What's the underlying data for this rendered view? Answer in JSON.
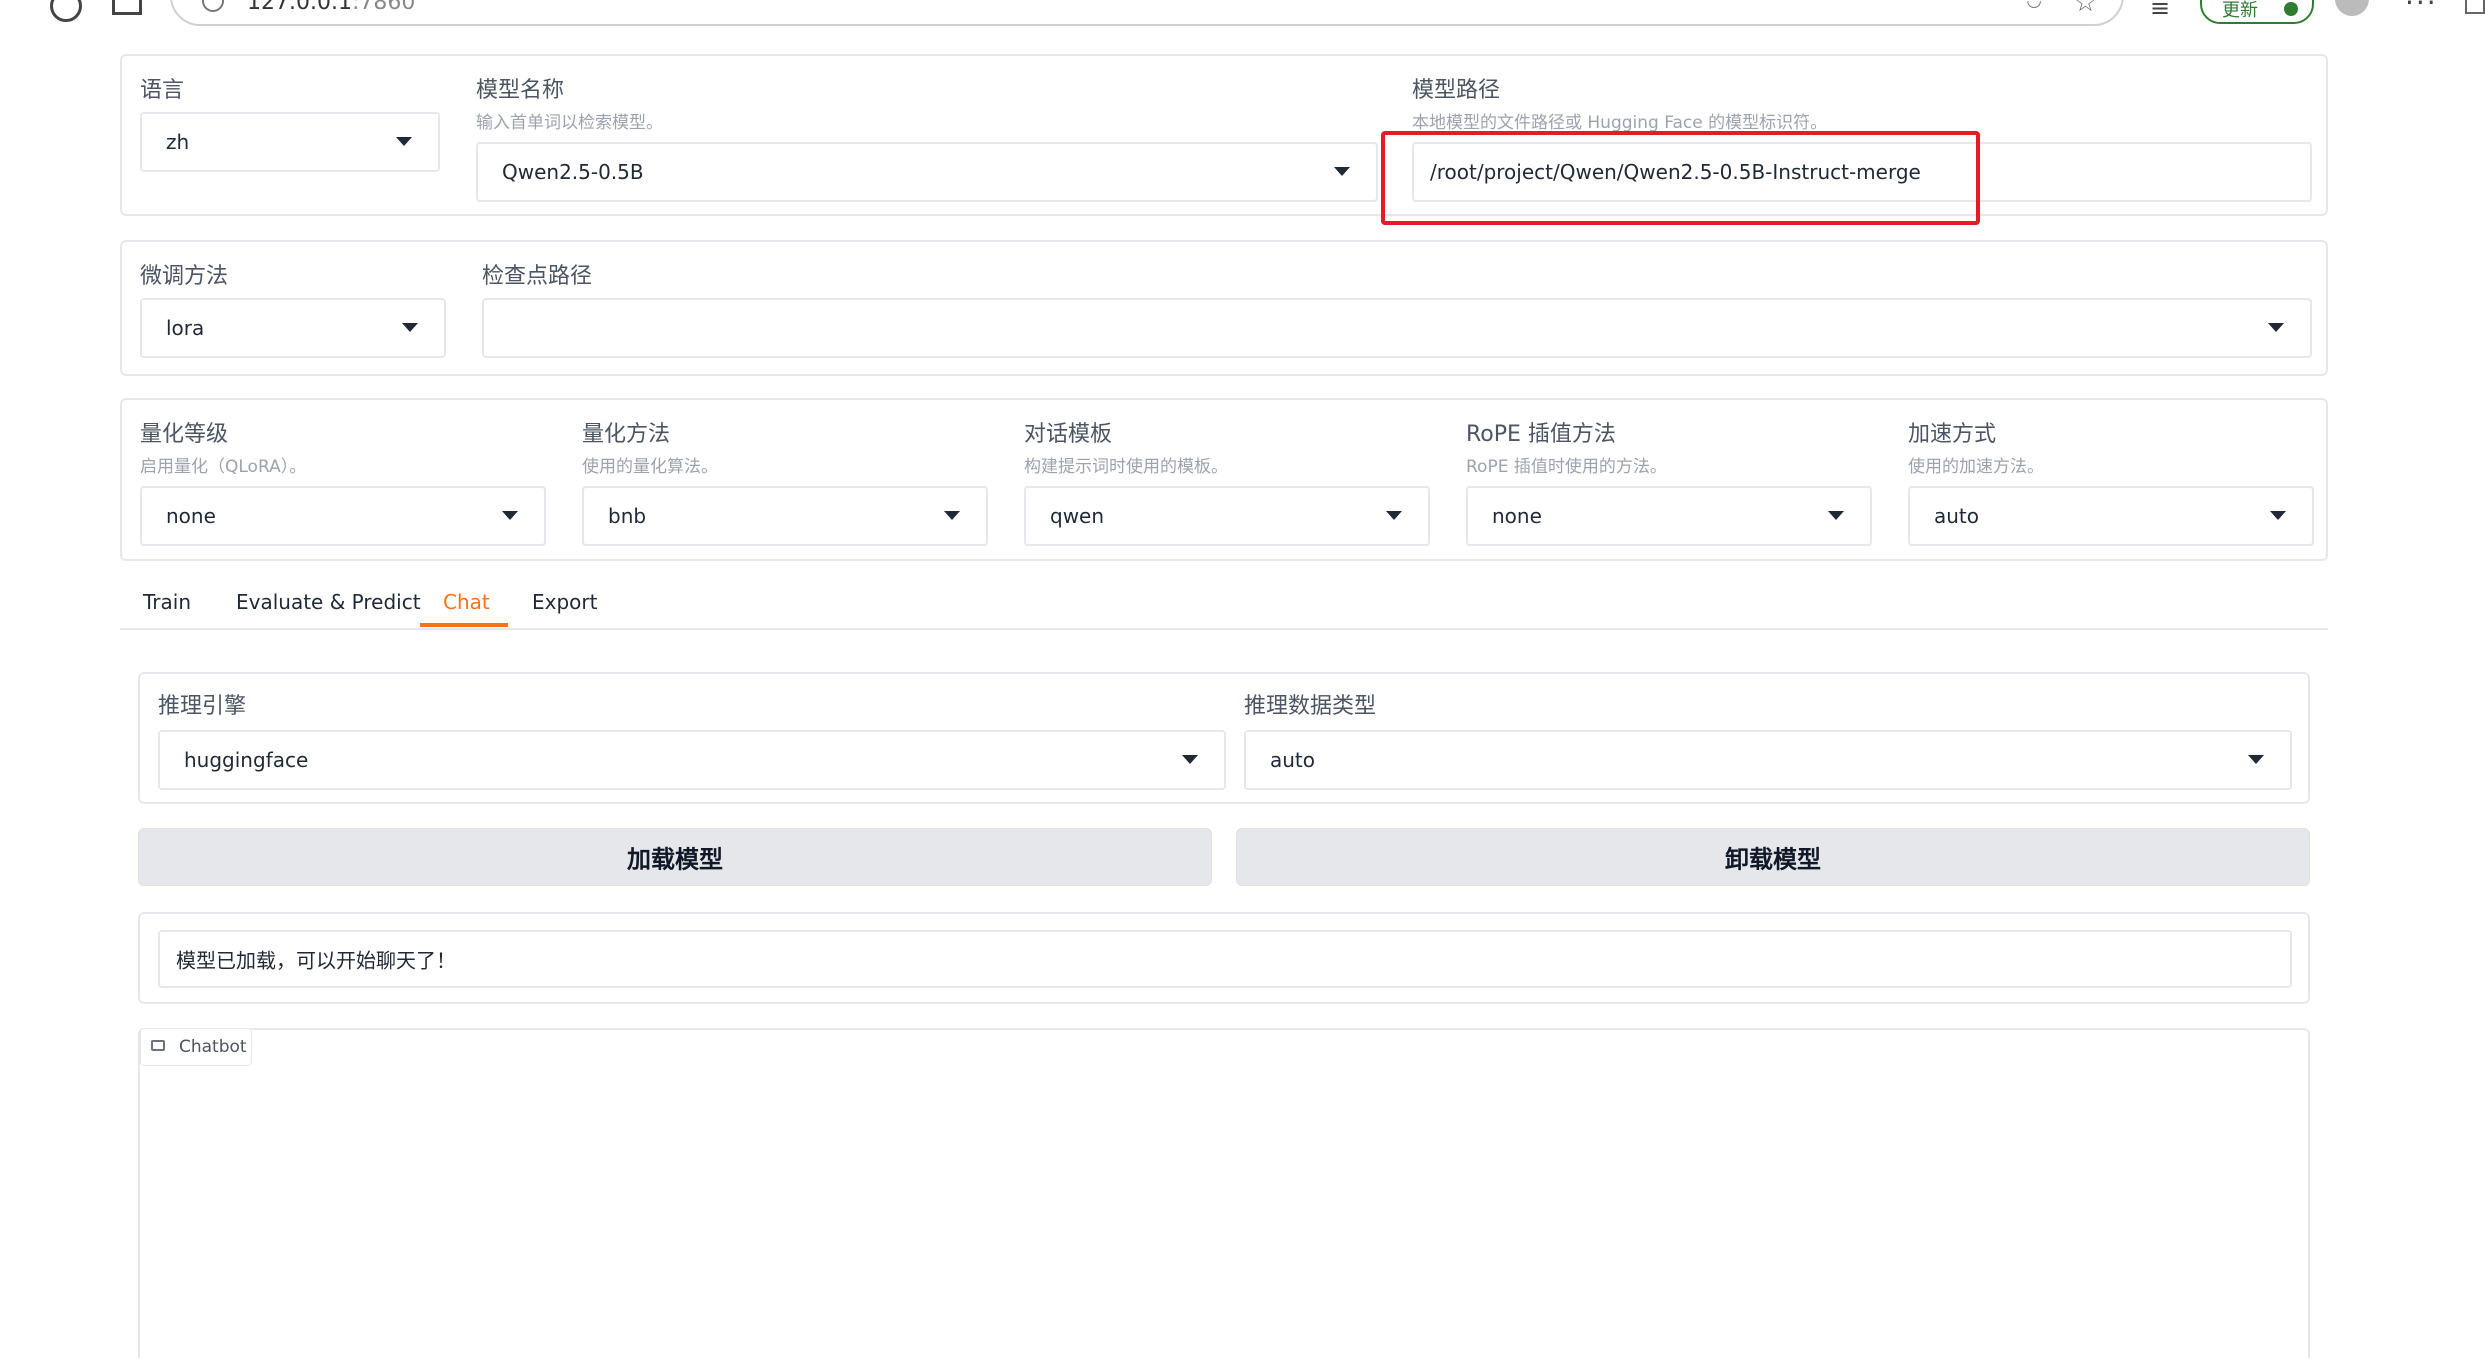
{
  "browser": {
    "url_host": "127.0.0.1",
    "url_port": ":7860",
    "update_label": "更新"
  },
  "top_panel": {
    "lang": {
      "label": "语言",
      "value": "zh"
    },
    "model_name": {
      "label": "模型名称",
      "info": "输入首单词以检索模型。",
      "value": "Qwen2.5-0.5B"
    },
    "model_path": {
      "label": "模型路径",
      "info": "本地模型的文件路径或 Hugging Face 的模型标识符。",
      "value": "/root/project/Qwen/Qwen2.5-0.5B-Instruct-merge"
    }
  },
  "finetune_panel": {
    "method": {
      "label": "微调方法",
      "value": "lora"
    },
    "checkpoint": {
      "label": "检查点路径",
      "value": ""
    }
  },
  "advanced_panel": {
    "quant_bit": {
      "label": "量化等级",
      "info": "启用量化（QLoRA）。",
      "value": "none"
    },
    "quant_method": {
      "label": "量化方法",
      "info": "使用的量化算法。",
      "value": "bnb"
    },
    "template": {
      "label": "对话模板",
      "info": "构建提示词时使用的模板。",
      "value": "qwen"
    },
    "rope": {
      "label": "RoPE 插值方法",
      "info": "RoPE 插值时使用的方法。",
      "value": "none"
    },
    "booster": {
      "label": "加速方式",
      "info": "使用的加速方法。",
      "value": "auto"
    }
  },
  "tabs": [
    {
      "label": "Train"
    },
    {
      "label": "Evaluate & Predict"
    },
    {
      "label": "Chat",
      "active": true
    },
    {
      "label": "Export"
    }
  ],
  "chat": {
    "infer_backend": {
      "label": "推理引擎",
      "value": "huggingface"
    },
    "infer_dtype": {
      "label": "推理数据类型",
      "value": "auto"
    },
    "load_button": "加载模型",
    "unload_button": "卸载模型",
    "info_box": "模型已加载，可以开始聊天了！",
    "chatbot_label": "Chatbot"
  },
  "colors": {
    "accent": "#f97316",
    "highlight": "#e11d2a"
  }
}
